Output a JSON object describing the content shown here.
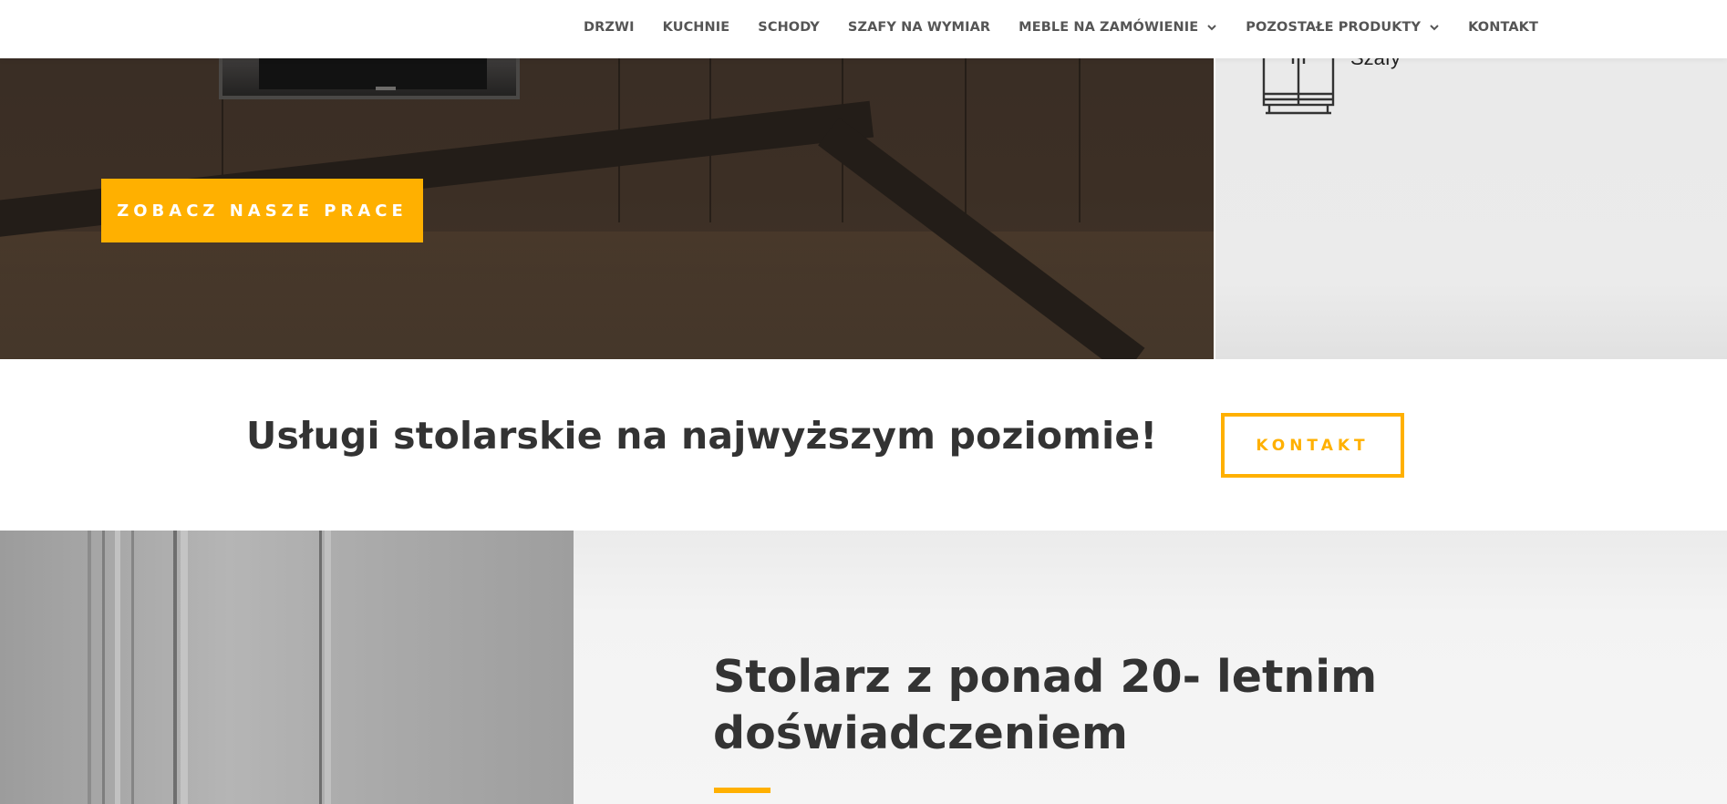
{
  "nav": {
    "items": [
      {
        "label": "DRZWI",
        "dropdown": false
      },
      {
        "label": "KUCHNIE",
        "dropdown": false
      },
      {
        "label": "SCHODY",
        "dropdown": false
      },
      {
        "label": "SZAFY NA WYMIAR",
        "dropdown": false
      },
      {
        "label": "MEBLE NA ZAMÓWIENIE",
        "dropdown": true
      },
      {
        "label": "POZOSTAŁE PRODUKTY",
        "dropdown": true
      },
      {
        "label": "KONTAKT",
        "dropdown": false
      }
    ]
  },
  "hero": {
    "cta_label": "ZOBACZ NASZE PRACE",
    "side_item": {
      "icon": "wardrobe-icon",
      "label": "Szafy"
    }
  },
  "tagline_section": {
    "text": "Usługi stolarskie na najwyższym poziomie!",
    "cta_label": "KONTAKT"
  },
  "about": {
    "heading": "Stolarz z ponad 20- letnim doświadczeniem"
  },
  "colors": {
    "accent": "#ffb000",
    "text": "#333333",
    "nav_text": "#555555"
  }
}
